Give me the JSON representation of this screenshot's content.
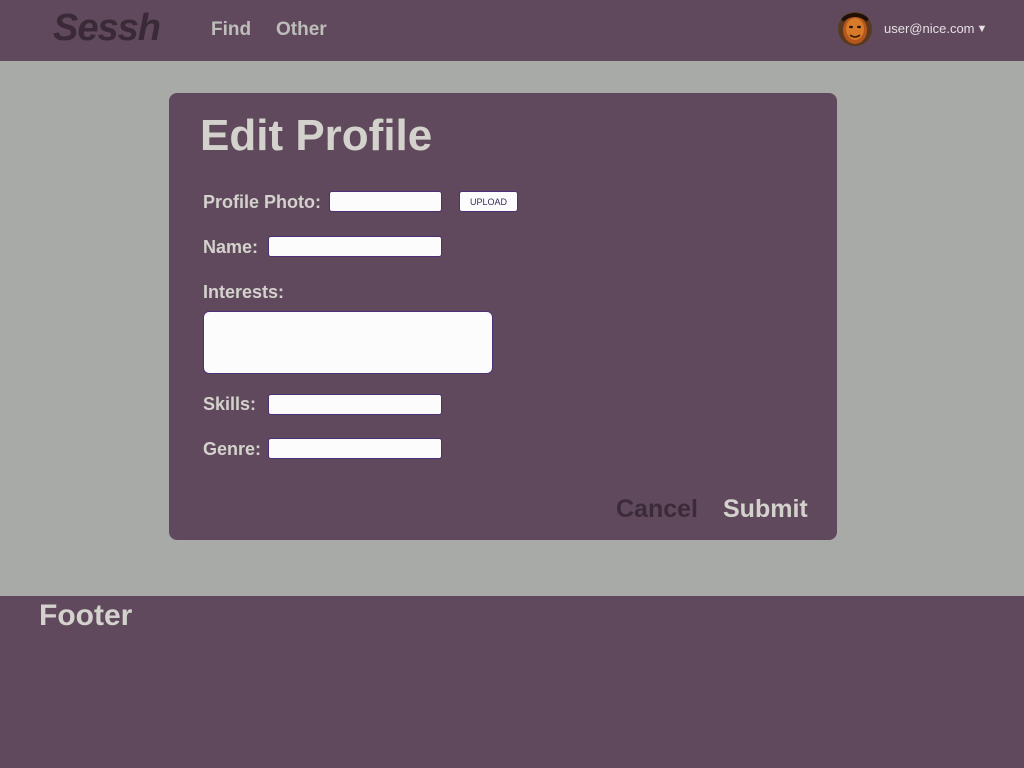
{
  "header": {
    "logo": "Sessh",
    "nav": [
      {
        "label": "Find"
      },
      {
        "label": "Other"
      }
    ],
    "user": {
      "email": "user@nice.com",
      "caret": "▼",
      "avatar_icon": "user-avatar-icon"
    }
  },
  "form": {
    "title": "Edit Profile",
    "profile_photo_label": "Profile Photo:",
    "profile_photo_value": "",
    "upload_label": "UPLOAD",
    "name_label": "Name:",
    "name_value": "",
    "interests_label": "Interests:",
    "interests_value": "",
    "skills_label": "Skills:",
    "skills_value": "",
    "genre_label": "Genre:",
    "genre_value": "",
    "cancel_label": "Cancel",
    "submit_label": "Submit"
  },
  "footer": {
    "text": "Footer"
  },
  "colors": {
    "header_bg": "#61495d",
    "page_bg": "#a8aaa8",
    "text_light": "#d4d2cd",
    "input_border": "#4b3178"
  }
}
